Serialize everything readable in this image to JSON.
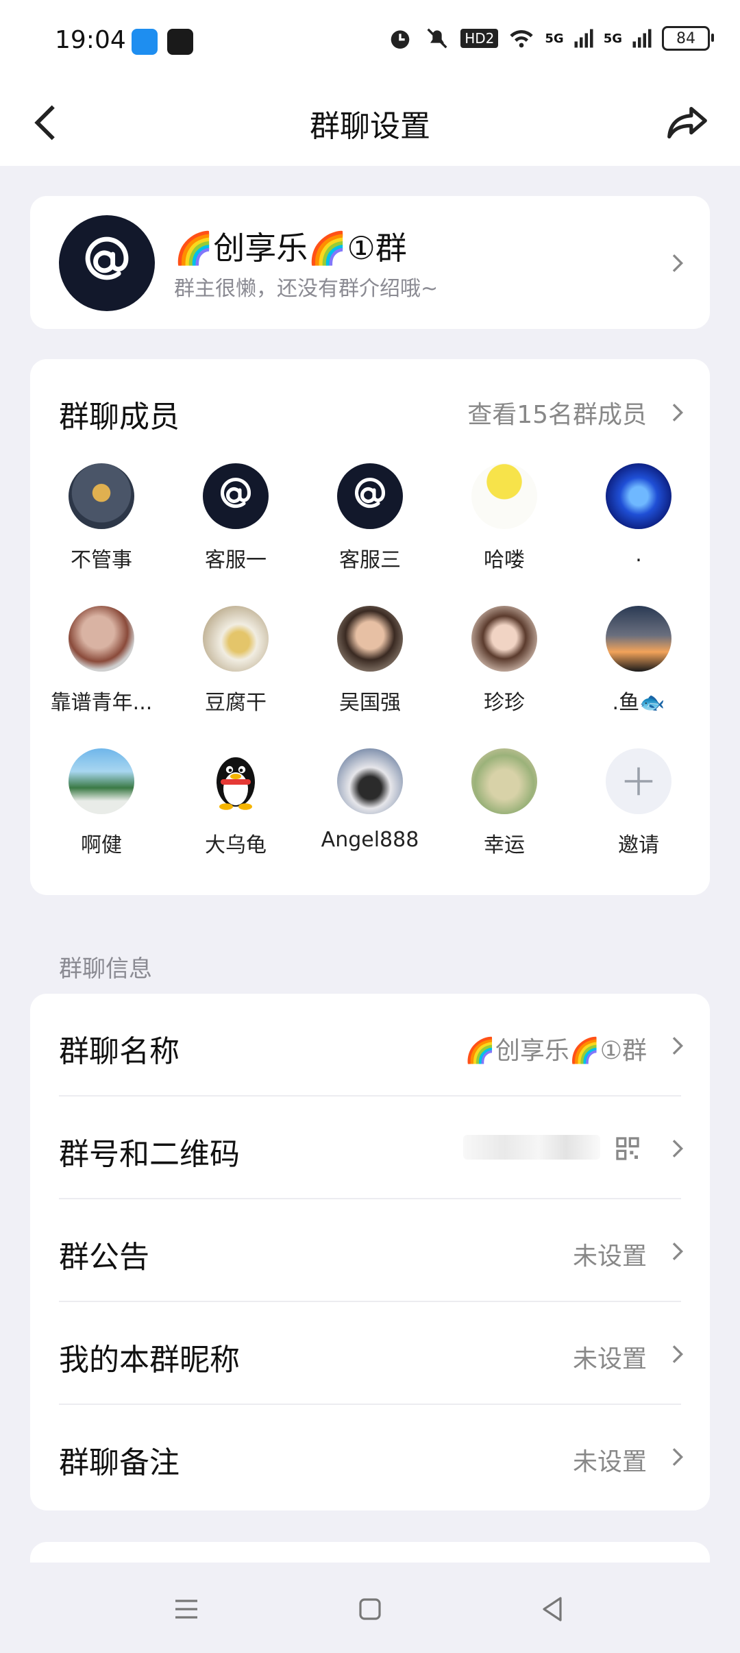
{
  "status_bar": {
    "time": "19:04",
    "battery": "84",
    "network_badges": [
      "HD2",
      "5G",
      "5G"
    ]
  },
  "nav": {
    "title": "群聊设置"
  },
  "group": {
    "name": "🌈创享乐🌈①群",
    "description": "群主很懒，还没有群介绍哦~"
  },
  "members": {
    "title": "群聊成员",
    "view_all": "查看15名群成员",
    "list": [
      {
        "name": "不管事"
      },
      {
        "name": "客服一"
      },
      {
        "name": "客服三"
      },
      {
        "name": "哈喽"
      },
      {
        "name": "."
      },
      {
        "name": "靠谱青年..."
      },
      {
        "name": "豆腐干"
      },
      {
        "name": "吴国强"
      },
      {
        "name": "珍珍"
      },
      {
        "name": ".鱼🐟"
      },
      {
        "name": "啊健"
      },
      {
        "name": "大乌龟"
      },
      {
        "name": "Angel888"
      },
      {
        "name": "幸运"
      }
    ],
    "invite_label": "邀请"
  },
  "info": {
    "section_label": "群聊信息",
    "rows": [
      {
        "label": "群聊名称",
        "value": "🌈创享乐🌈①群"
      },
      {
        "label": "群号和二维码",
        "value": ""
      },
      {
        "label": "群公告",
        "value": "未设置"
      },
      {
        "label": "我的本群昵称",
        "value": "未设置"
      },
      {
        "label": "群聊备注",
        "value": "未设置"
      }
    ]
  },
  "colors": {
    "background": "#f0f0f6",
    "card": "#ffffff",
    "text_secondary": "#888888",
    "logo_dark": "#12182b"
  }
}
